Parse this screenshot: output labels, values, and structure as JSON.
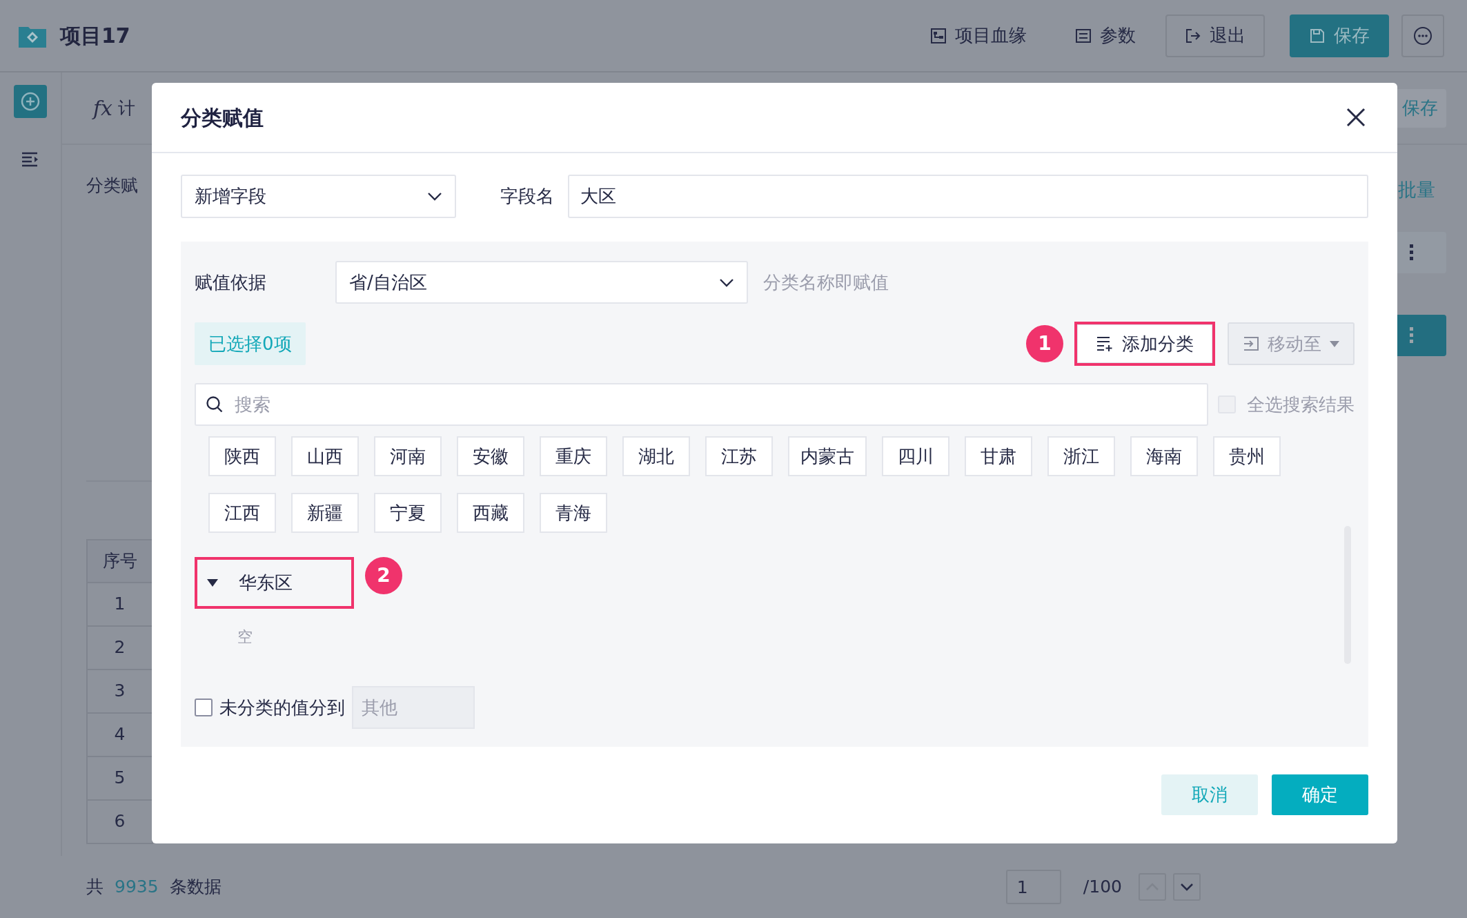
{
  "app": {
    "title": "项目17",
    "toolbar": [
      {
        "label": "项目血缘",
        "kind": "link"
      },
      {
        "label": "参数",
        "kind": "link"
      },
      {
        "label": "退出",
        "kind": "outline"
      },
      {
        "label": "保存",
        "kind": "primary"
      }
    ]
  },
  "background": {
    "formula_symbol": "fx",
    "formula_tab": "计",
    "save": "保存",
    "section_label": "分类赋",
    "batch": "批量",
    "table": {
      "columns": [
        "序号"
      ],
      "rows": [
        "1",
        "2",
        "3",
        "4",
        "5",
        "6"
      ]
    },
    "footer": {
      "prefix": "共",
      "count": "9935",
      "suffix": "条数据",
      "page": "1",
      "total_pages": "/100"
    }
  },
  "dialog": {
    "title": "分类赋值",
    "field_mode": "新增字段",
    "field_name_label": "字段名",
    "field_name": "大区",
    "basis_label": "赋值依据",
    "basis": "省/自治区",
    "basis_hint": "分类名称即赋值",
    "selected_count": "已选择0项",
    "add_category": {
      "label": "添加分类",
      "marker": "1"
    },
    "move_to": {
      "label": "移动至",
      "disabled": true
    },
    "search": {
      "placeholder": "搜索"
    },
    "select_all_results": {
      "label": "全选搜索结果",
      "checked": false,
      "disabled": true
    },
    "values": [
      "陕西",
      "山西",
      "河南",
      "安徽",
      "重庆",
      "湖北",
      "江苏",
      "内蒙古",
      "四川",
      "甘肃",
      "浙江",
      "海南",
      "贵州",
      "江西",
      "新疆",
      "宁夏",
      "西藏",
      "青海"
    ],
    "categories": [
      {
        "name": "华东区",
        "expanded": true,
        "marker": "2",
        "empty_text": "空"
      }
    ],
    "unclassified": {
      "label": "未分类的值分到",
      "checked": false,
      "target": "其他"
    },
    "buttons": [
      {
        "label": "取消",
        "kind": "secondary"
      },
      {
        "label": "确定",
        "kind": "primary"
      }
    ]
  }
}
